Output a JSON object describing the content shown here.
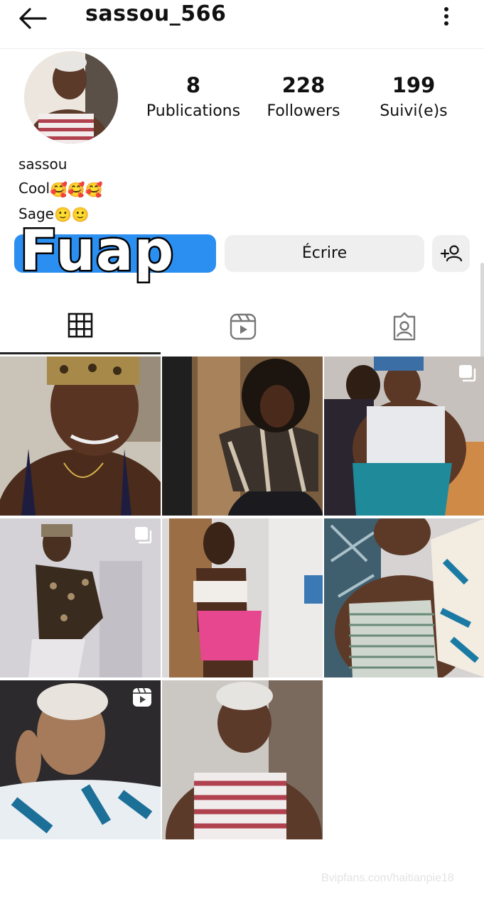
{
  "header": {
    "username": "sassou_566",
    "back_icon": "arrow-left-icon",
    "menu_icon": "more-vertical-icon"
  },
  "profile": {
    "stats": [
      {
        "value": "8",
        "label": "Publications"
      },
      {
        "value": "228",
        "label": "Followers"
      },
      {
        "value": "199",
        "label": "Suivi(e)s"
      }
    ],
    "bio_name": "sassou",
    "bio_line1": "Cool",
    "bio_line1_emoji": "🥰🥰🥰",
    "bio_line2": "Sage",
    "bio_line2_emoji": "🙂🙂"
  },
  "actions": {
    "follow_overlay_text": "Fuap",
    "write_label": "Écrire",
    "suggest_icon": "person-add-icon"
  },
  "tabs": [
    {
      "name": "posts",
      "icon": "grid-icon",
      "active": true
    },
    {
      "name": "reels",
      "icon": "reels-icon",
      "active": false
    },
    {
      "name": "tagged",
      "icon": "tagged-person-icon",
      "active": false
    }
  ],
  "posts": [
    {
      "badge": ""
    },
    {
      "badge": ""
    },
    {
      "badge": "carousel-icon"
    },
    {
      "badge": "carousel-icon"
    },
    {
      "badge": ""
    },
    {
      "badge": ""
    },
    {
      "badge": "reel-icon"
    },
    {
      "badge": ""
    }
  ],
  "watermark": "Bvipfans.com/haitianpie18",
  "colors": {
    "follow_button": "#2a8ff0",
    "secondary_button": "#efefef"
  }
}
